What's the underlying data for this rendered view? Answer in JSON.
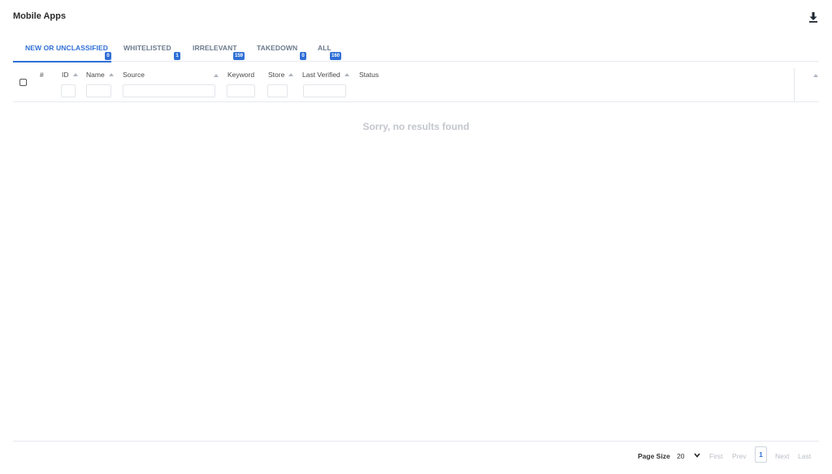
{
  "header": {
    "title": "Mobile Apps",
    "download_icon": "download-icon"
  },
  "tabs": [
    {
      "label": "NEW OR UNCLASSIFIED",
      "count": "0",
      "active": true
    },
    {
      "label": "WHITELISTED",
      "count": "1",
      "active": false
    },
    {
      "label": "IRRELEVANT",
      "count": "159",
      "active": false
    },
    {
      "label": "TAKEDOWN",
      "count": "0",
      "active": false
    },
    {
      "label": "ALL",
      "count": "160",
      "active": false
    }
  ],
  "table": {
    "columns": [
      "#",
      "ID",
      "Name",
      "Source",
      "Keyword",
      "Store",
      "Last Verified",
      "Status"
    ],
    "empty_message": "Sorry, no results found"
  },
  "pagination": {
    "page_size_label": "Page Size",
    "page_size": "20",
    "first": "First",
    "prev": "Prev",
    "current_page": "1",
    "next": "Next",
    "last": "Last"
  },
  "colors": {
    "accent": "#2f6fd6",
    "border": "#e7e9ee",
    "muted_text": "#c3c6cc"
  }
}
